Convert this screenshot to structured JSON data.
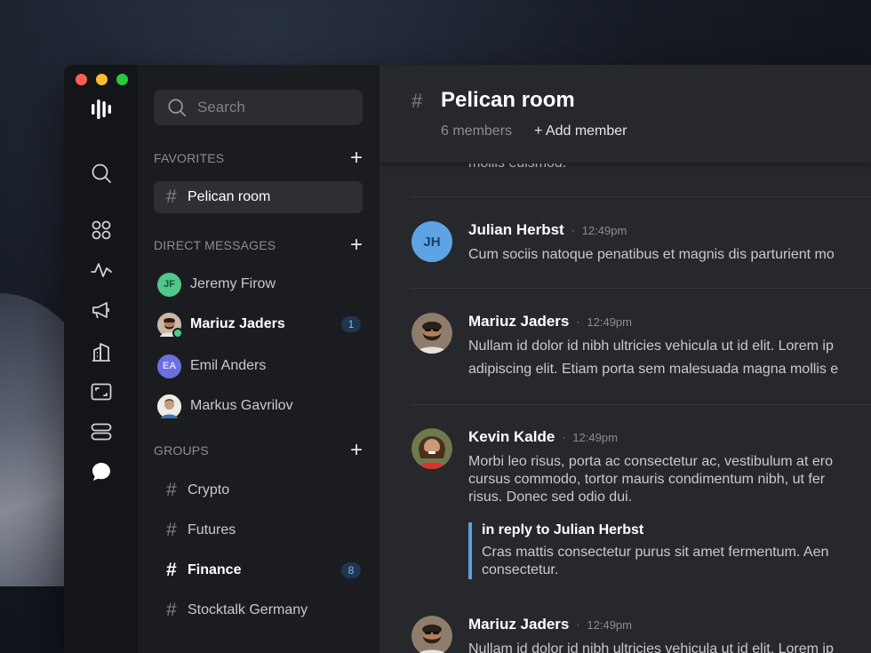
{
  "window": {
    "lights": [
      "#ff5f57",
      "#febc2e",
      "#28c840"
    ]
  },
  "rail": {
    "items": [
      {
        "icon": "search-icon",
        "active": false
      },
      {
        "icon": "grid-icon",
        "active": false
      },
      {
        "icon": "activity-icon",
        "active": false
      },
      {
        "icon": "megaphone-icon",
        "active": false
      },
      {
        "icon": "building-icon",
        "active": false
      },
      {
        "icon": "frame-icon",
        "active": false
      },
      {
        "icon": "server-icon",
        "active": false
      },
      {
        "icon": "chat-bubble-icon",
        "active": true
      }
    ]
  },
  "sidebar": {
    "search_placeholder": "Search",
    "favorites": {
      "title": "FAVORITES",
      "items": [
        {
          "label": "Pelican room",
          "active": true
        }
      ]
    },
    "direct_messages": {
      "title": "DIRECT MESSAGES",
      "items": [
        {
          "label": "Jeremy Firow",
          "initials": "JF",
          "color": "#4fc98a",
          "unread": false
        },
        {
          "label": "Mariuz Jaders",
          "initials": "",
          "online": true,
          "unread": true,
          "badge": "1"
        },
        {
          "label": "Emil Anders",
          "initials": "EA",
          "color": "#6b6fe0",
          "unread": false
        },
        {
          "label": "Markus Gavrilov",
          "initials": "",
          "unread": false
        }
      ]
    },
    "groups": {
      "title": "GROUPS",
      "items": [
        {
          "label": "Crypto"
        },
        {
          "label": "Futures"
        },
        {
          "label": "Finance",
          "unread": true,
          "badge": "8"
        },
        {
          "label": "Stocktalk Germany"
        }
      ]
    }
  },
  "room": {
    "hash": "#",
    "title": "Pelican room",
    "members": "6 members",
    "add_member": "+ Add member"
  },
  "messages": {
    "partial_text": "mollis euismod.",
    "list": [
      {
        "author": "Julian Herbst",
        "time": "12:49pm",
        "initials": "JH",
        "avatar_color": "#5ea3e3",
        "lines": [
          "Cum sociis natoque penatibus et magnis dis parturient mo"
        ]
      },
      {
        "author": "Mariuz Jaders",
        "time": "12:49pm",
        "lines": [
          "Nullam id dolor id nibh ultricies vehicula ut id elit. Lorem ip",
          "adipiscing elit. Etiam porta sem malesuada magna mollis e"
        ]
      },
      {
        "author": "Kevin Kalde",
        "time": "12:49pm",
        "lines": [
          "Morbi leo risus, porta ac consectetur ac, vestibulum at ero",
          "cursus commodo, tortor mauris condimentum nibh, ut fer",
          "risus. Donec sed odio dui."
        ],
        "reply": {
          "title": "in reply to Julian Herbst",
          "lines": [
            "Cras mattis consectetur purus sit amet fermentum. Aen",
            "consectetur."
          ]
        }
      },
      {
        "author": "Mariuz Jaders",
        "time": "12:49pm",
        "lines": [
          "Nullam id dolor id nibh ultricies vehicula ut id elit. Lorem ip"
        ]
      }
    ]
  }
}
